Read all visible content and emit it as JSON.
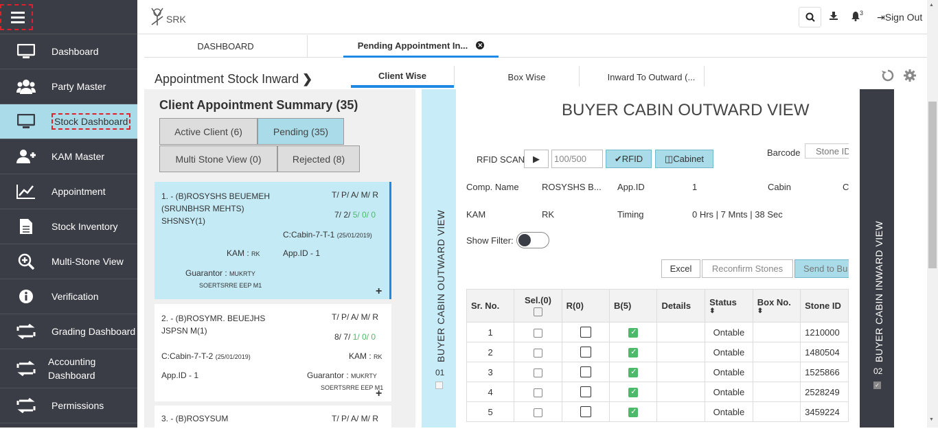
{
  "sidebar": {
    "items": [
      {
        "label": "Dashboard",
        "icon": "monitor-icon"
      },
      {
        "label": "Party Master",
        "icon": "users-icon"
      },
      {
        "label": "Stock Dashboard",
        "icon": "monitor-icon"
      },
      {
        "label": "KAM Master",
        "icon": "user-plus-icon"
      },
      {
        "label": "Appointment",
        "icon": "line-chart-icon"
      },
      {
        "label": "Stock Inventory",
        "icon": "file-icon"
      },
      {
        "label": "Multi-Stone View",
        "icon": "zoom-in-icon"
      },
      {
        "label": "Verification",
        "icon": "info-icon"
      },
      {
        "label": "Grading Dashboard",
        "icon": "exchange-icon"
      },
      {
        "label": "Accounting Dashboard",
        "icon": "exchange-icon"
      },
      {
        "label": "Permissions",
        "icon": "exchange-icon"
      }
    ]
  },
  "topbar": {
    "logo_text": "SRK",
    "notif_count": "3",
    "signout": "Sign Out"
  },
  "page_tabs": {
    "dashboard": "DASHBOARD",
    "pending": "Pending Appointment In..."
  },
  "subheader": {
    "title": "Appointment Stock Inward",
    "tabs": [
      "Client Wise",
      "Box Wise",
      "Inward To Outward (..."
    ]
  },
  "left": {
    "title": "Client Appointment Summary (35)",
    "filters": {
      "active": "Active Client (6)",
      "pending": "Pending (35)",
      "multi": "Multi Stone View (0)",
      "rejected": "Rejected (8)"
    },
    "cards": [
      {
        "name": "1. - (B)ROSYSHS BEUEMEH (SRUNBHSR MEHTS) SHSNSY(1)",
        "tpam": "T/ P/ A/ M/ R",
        "counts_a": "7/ 2/ ",
        "counts_b": "5/ 0/ 0",
        "cabin": "C:Cabin-7-T-1",
        "date": "(25/01/2019)",
        "kam_label": "KAM : ",
        "kam": "RK",
        "appid": "App.ID - 1",
        "guarantor_label": "Guarantor : ",
        "guarantor": "MUKRTY",
        "guarantor2": "SOERTSRRE EEP M1"
      },
      {
        "name": "2. - (B)ROSYMR. BEUEJHS JSPSN M(1)",
        "tpam": "T/ P/ A/ M/ R",
        "counts_a": "8/ 7/ ",
        "counts_b": "1/ 0/ 0",
        "cabin": "C:Cabin-7-T-2",
        "date": "(25/01/2019)",
        "kam_label": "KAM : ",
        "kam": "RK",
        "appid": "App.ID - 1",
        "guarantor_label": "Guarantor : ",
        "guarantor": "MUKRTY",
        "guarantor2": "SOERTSRRE EEP M1"
      },
      {
        "name": "3. - (B)ROSYSUM",
        "tpam": "T/ P/ A/ M/ R"
      }
    ]
  },
  "outward": {
    "strip_label": "BUYER CABIN OUTWARD VIEW",
    "strip_num": "01",
    "heading": "BUYER CABIN OUTWARD VIEW",
    "rfid_label": "RFID SCAN",
    "rfid_value": "100/500",
    "rfid_btn": "RFID",
    "cabinet_btn": "Cabinet",
    "barcode_label": "Barcode",
    "barcode_placeholder": "Stone ID",
    "comp_label": "Comp. Name",
    "comp_value": "ROSYSHS B...",
    "appid_label": "App.ID",
    "appid_value": "1",
    "cabin_label": "Cabin",
    "cabin_value": "C",
    "kam_label": "KAM",
    "kam_value": "RK",
    "timing_label": "Timing",
    "timing_value": "0 Hrs | 7 Mnts | 38 Sec",
    "filter_label": "Show Filter:",
    "excel": "Excel",
    "reconfirm": "Reconfirm Stones",
    "send": "Send to Bu",
    "columns": [
      "Sr. No.",
      "Sel.(0)",
      "R(0)",
      "B(5)",
      "Details",
      "Status",
      "Box No.",
      "Stone ID"
    ],
    "rows": [
      {
        "sr": "1",
        "status": "Ontable",
        "stone": "1210000"
      },
      {
        "sr": "2",
        "status": "Ontable",
        "stone": "1480504"
      },
      {
        "sr": "3",
        "status": "Ontable",
        "stone": "1525866"
      },
      {
        "sr": "4",
        "status": "Ontable",
        "stone": "2528249"
      },
      {
        "sr": "5",
        "status": "Ontable",
        "stone": "3459224"
      }
    ]
  },
  "inward": {
    "strip_label": "BUYER CABIN INWARD VIEW",
    "strip_num": "02"
  }
}
